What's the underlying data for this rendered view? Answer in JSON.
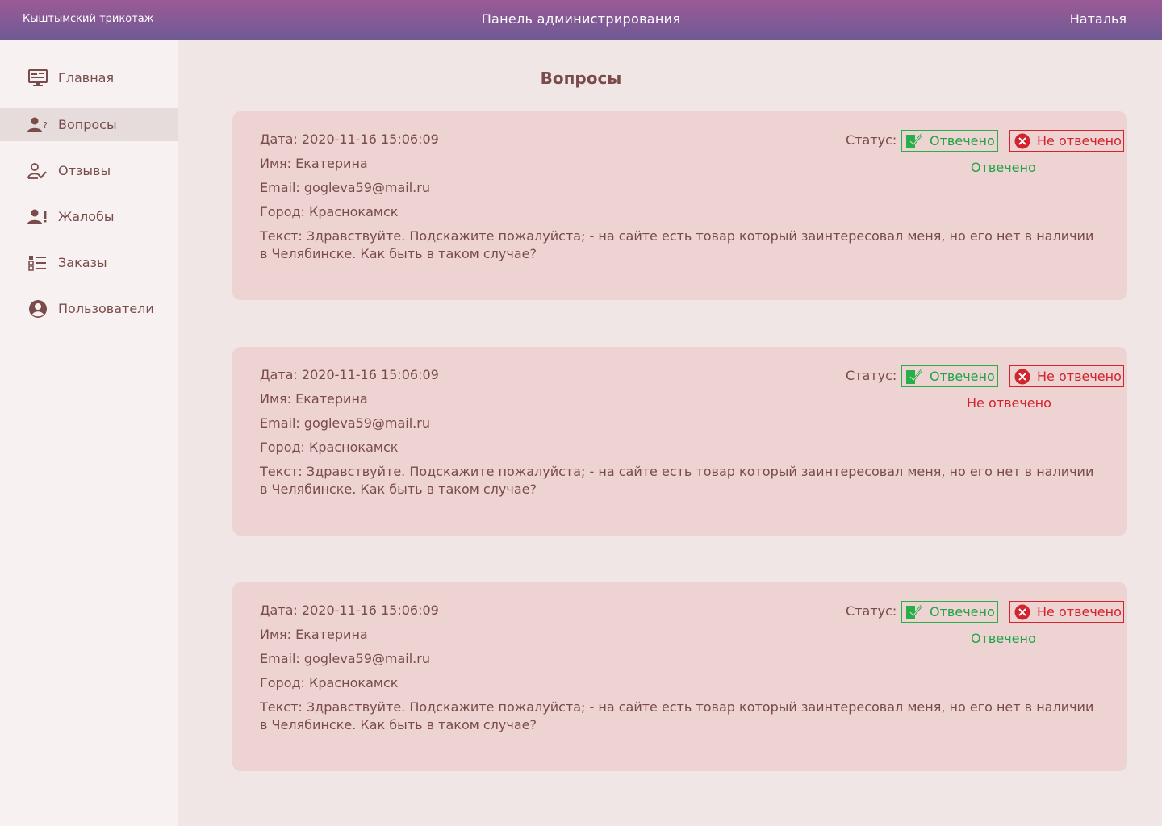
{
  "header": {
    "brand": "Кыштымский трикотаж",
    "title": "Панель администрирования",
    "user": "Наталья"
  },
  "sidebar": {
    "items": [
      {
        "label": "Главная",
        "icon": "monitor-icon"
      },
      {
        "label": "Вопросы",
        "icon": "user-question-icon"
      },
      {
        "label": "Отзывы",
        "icon": "user-check-icon"
      },
      {
        "label": "Жалобы",
        "icon": "user-exclamation-icon"
      },
      {
        "label": "Заказы",
        "icon": "list-icon"
      },
      {
        "label": "Пользователи",
        "icon": "user-circle-icon"
      }
    ]
  },
  "page": {
    "title": "Вопросы"
  },
  "colors": {
    "answered": "#1fa443",
    "not_answered": "#d3232c",
    "card_bg": "#eed3d3"
  },
  "questions": [
    {
      "date": "Дата: 2020-11-16 15:06:09",
      "name": "Имя: Екатерина",
      "email": "Email: gogleva59@mail.ru",
      "city": "Город: Краснокамск",
      "text": "Текст: Здравствуйте. Подскажите пожалуйста; - на сайте есть товар который заинтересовал меня, но его нет в наличии в Челябинске. Как быть в таком случае?",
      "status_label": "Статус:",
      "btn_answered": "Отвечено",
      "btn_not_answered": "Не отвечено",
      "status": "Отвечено"
    },
    {
      "date": "Дата: 2020-11-16 15:06:09",
      "name": "Имя: Екатерина",
      "email": "Email: gogleva59@mail.ru",
      "city": "Город: Краснокамск",
      "text": "Текст: Здравствуйте. Подскажите пожалуйста; - на сайте есть товар который заинтересовал меня, но его нет в наличии в Челябинске. Как быть в таком случае?",
      "status_label": "Статус:",
      "btn_answered": "Отвечено",
      "btn_not_answered": "Не отвечено",
      "status": "Не отвечено"
    },
    {
      "date": "Дата: 2020-11-16 15:06:09",
      "name": "Имя: Екатерина",
      "email": "Email: gogleva59@mail.ru",
      "city": "Город: Краснокамск",
      "text": "Текст: Здравствуйте. Подскажите пожалуйста; - на сайте есть товар который заинтересовал меня, но его нет в наличии в Челябинске. Как быть в таком случае?",
      "status_label": "Статус:",
      "btn_answered": "Отвечено",
      "btn_not_answered": "Не отвечено",
      "status": "Отвечено"
    }
  ]
}
